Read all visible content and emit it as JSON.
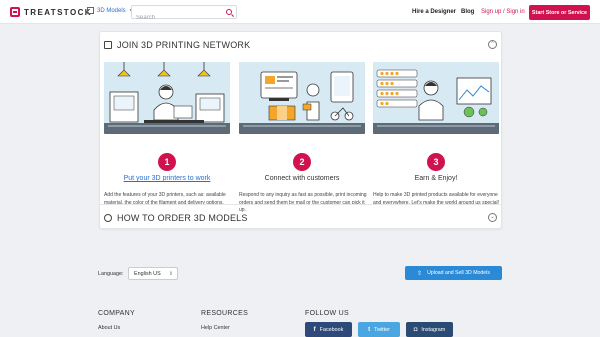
{
  "header": {
    "logo_text": "TREATSTOCK",
    "category_label": "3D Models",
    "search_placeholder": "Search",
    "hire_label": "Hire a Designer",
    "blog_label": "Blog",
    "signup_label": "Sign up",
    "separator": "/",
    "signin_label": "Sign in",
    "cta_label": "Start Store or Service",
    "brand_color": "#d0134e"
  },
  "join_section": {
    "title": "JOIN 3D PRINTING NETWORK",
    "steps": [
      {
        "number": "1",
        "title": "Put your 3D printers to work",
        "description": "Add the features of your 3D printers, such as: available material, the color of the filament and delivery options."
      },
      {
        "number": "2",
        "title": "Connect with customers",
        "description": "Respond to any inquiry as fast as possible, print incoming orders and send them by mail or the customer can pick it up."
      },
      {
        "number": "3",
        "title": "Earn & Enjoy!",
        "description": "Help to make 3D printed products available for everyone and everywhere. Let's make the world around us special!"
      }
    ],
    "illustration_text": {
      "box_label": "New orders",
      "logo_small": "TREATSTOCK"
    }
  },
  "order_section": {
    "title": "HOW TO ORDER 3D MODELS"
  },
  "footer": {
    "language_label": "Language:",
    "language_value": "English US",
    "upload_label": "Upload and Sell 3D Models",
    "company_heading": "COMPANY",
    "company_link": "About Us",
    "resources_heading": "RESOURCES",
    "resources_link": "Help Center",
    "follow_heading": "FOLLOW US",
    "social": [
      {
        "label": "Facebook",
        "icon": "f",
        "color": "#2d4a7a"
      },
      {
        "label": "Twitter",
        "icon": "t",
        "color": "#49a6e0"
      },
      {
        "label": "Instagram",
        "icon": "◘",
        "color": "#2a4b73"
      }
    ]
  }
}
